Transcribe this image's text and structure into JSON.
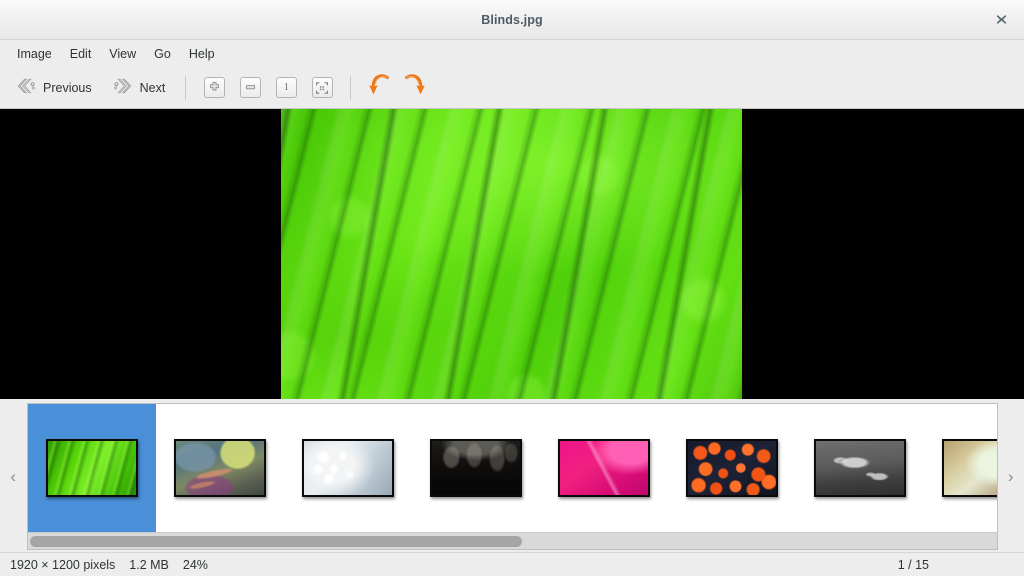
{
  "window": {
    "title": "Blinds.jpg",
    "close_label": "✕"
  },
  "menubar": {
    "items": [
      {
        "label": "Image",
        "name": "menu-image"
      },
      {
        "label": "Edit",
        "name": "menu-edit"
      },
      {
        "label": "View",
        "name": "menu-view"
      },
      {
        "label": "Go",
        "name": "menu-go"
      },
      {
        "label": "Help",
        "name": "menu-help"
      }
    ]
  },
  "toolbar": {
    "previous_label": "Previous",
    "next_label": "Next",
    "zoom_in_icon": "zoom-in-icon",
    "zoom_out_icon": "zoom-out-icon",
    "normal_size_icon": "normal-size-icon",
    "best_fit_icon": "best-fit-icon",
    "rotate_left_icon": "rotate-counterclockwise-icon",
    "rotate_right_icon": "rotate-clockwise-icon",
    "normal_size_glyph": "1",
    "accent_color": "#e8761a"
  },
  "image_view": {
    "background_color": "#000000",
    "subject": "green-leaf-macro"
  },
  "thumbnail_strip": {
    "prev_arrow": "‹",
    "next_arrow": "›",
    "selected_index": 0,
    "selection_color": "#4a90d9",
    "scroll_thumb_percent": "51%",
    "thumbnails": [
      {
        "name": "thumbnail-blinds",
        "art": "t-leaf"
      },
      {
        "name": "thumbnail-grass",
        "art": "t-grass"
      },
      {
        "name": "thumbnail-fluff",
        "art": "t-fluff"
      },
      {
        "name": "thumbnail-dark-leaves",
        "art": "t-darkleaf"
      },
      {
        "name": "thumbnail-pink",
        "art": "t-pink"
      },
      {
        "name": "thumbnail-orange-flowers",
        "art": "t-orange"
      },
      {
        "name": "thumbnail-water-drops",
        "art": "t-drops"
      },
      {
        "name": "thumbnail-warm-blur",
        "art": "t-warm"
      }
    ]
  },
  "statusbar": {
    "dimensions": "1920 × 1200 pixels",
    "filesize": "1.2 MB",
    "zoom": "24%",
    "position": "1 / 15"
  }
}
